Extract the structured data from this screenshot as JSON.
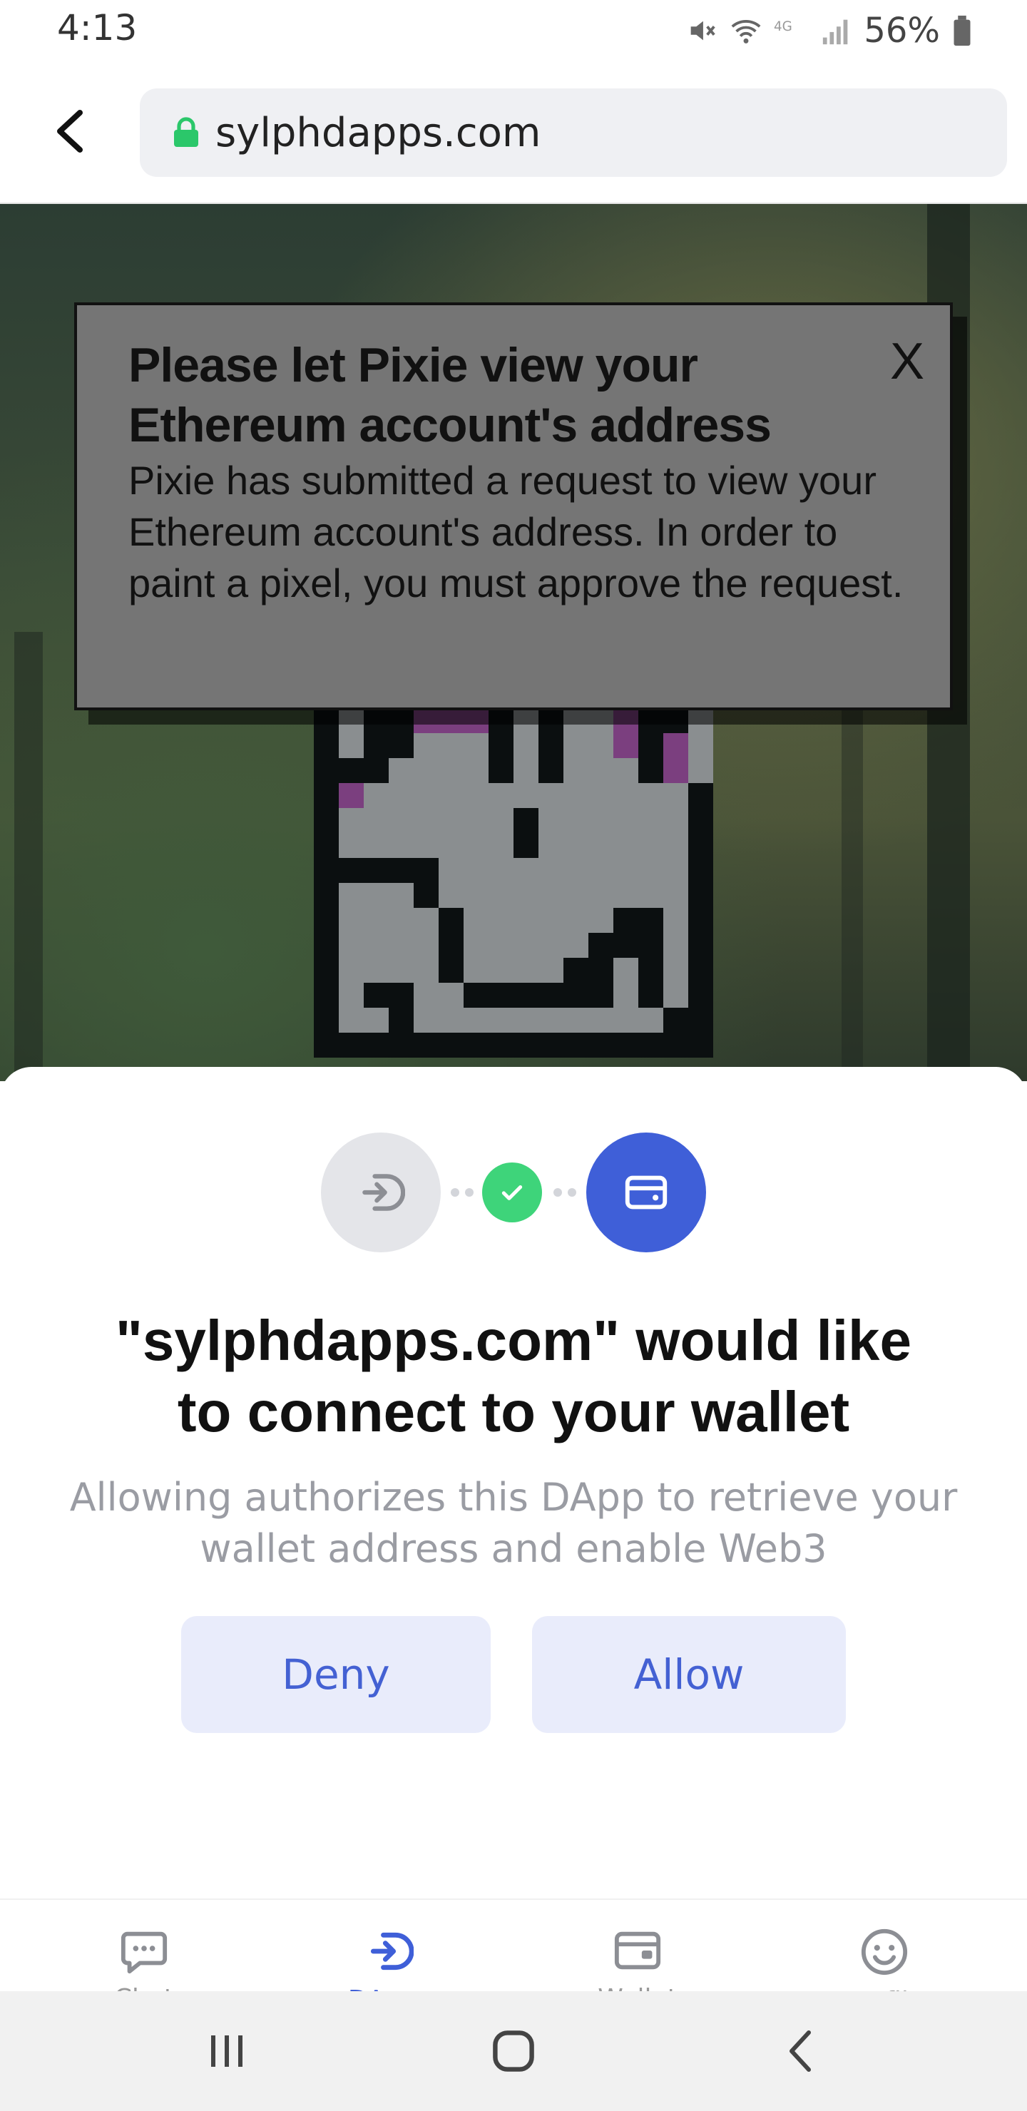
{
  "status_bar": {
    "time": "4:13",
    "battery": "56%",
    "icons": [
      "mute-icon",
      "wifi-icon",
      "lte-icon",
      "signal-icon",
      "battery-icon"
    ]
  },
  "browser": {
    "url": "sylphdapps.com",
    "back_icon": "chevron-left-icon",
    "lock_icon": "lock-icon",
    "lock_color": "#2bc76a"
  },
  "page_dialog": {
    "title": "Please let Pixie view your Ethereum account's address",
    "body": "Pixie has submitted a request to view your Ethereum account's address. In order to paint a pixel, you must approve the request.",
    "close_label": "X"
  },
  "connect_sheet": {
    "icons": [
      "dapp-login-icon",
      "check-icon",
      "wallet-icon"
    ],
    "title": "\"sylphdapps.com\" would like to connect to your wallet",
    "subtitle": "Allowing authorizes this DApp to retrieve your wallet address and enable Web3",
    "deny_label": "Deny",
    "allow_label": "Allow",
    "accent_color": "#3f5fd8",
    "success_color": "#3ed47a"
  },
  "tab_bar": {
    "tabs": [
      {
        "icon": "chat-icon",
        "label": "Chat",
        "active": false
      },
      {
        "icon": "dapp-icon",
        "label": "DApps",
        "active": true
      },
      {
        "icon": "wallet-icon",
        "label": "Wallet",
        "active": false
      },
      {
        "icon": "smiley-icon",
        "label": "Profile",
        "active": false
      }
    ]
  },
  "nav_bar": {
    "buttons": [
      "recents-icon",
      "home-icon",
      "back-icon"
    ]
  }
}
